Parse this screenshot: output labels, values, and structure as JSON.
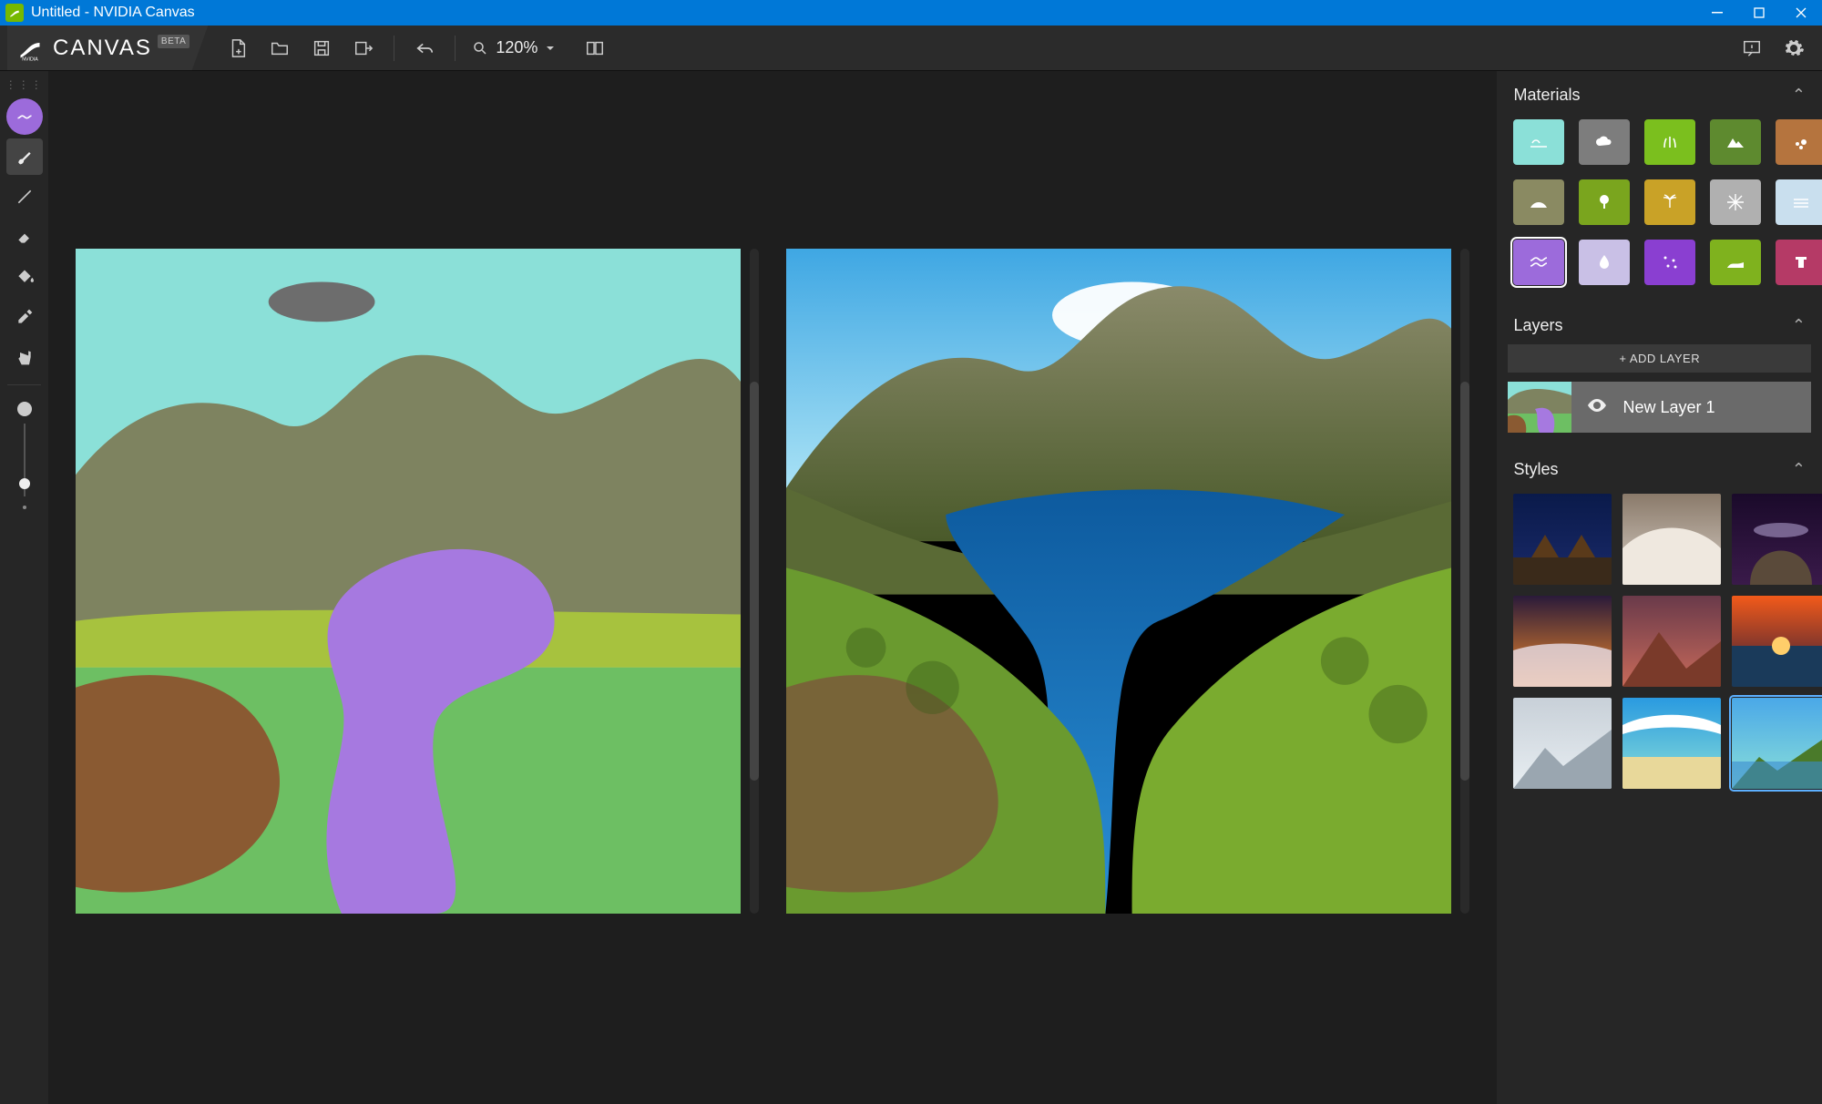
{
  "window": {
    "title": "Untitled - NVIDIA Canvas"
  },
  "brand": {
    "name": "CANVAS",
    "badge": "BETA"
  },
  "toolbar": {
    "zoom_label": "120%"
  },
  "tools": {
    "items": [
      "material",
      "brush",
      "line",
      "eraser",
      "fill",
      "eyedropper",
      "pan"
    ]
  },
  "sections": {
    "materials_title": "Materials",
    "layers_title": "Layers",
    "styles_title": "Styles",
    "add_layer_label": "+ ADD LAYER"
  },
  "materials": [
    {
      "name": "sky",
      "color": "#8be0d8",
      "icon": "sky"
    },
    {
      "name": "cloud",
      "color": "#7d7d7d",
      "icon": "cloud"
    },
    {
      "name": "grass",
      "color": "#7bbf1e",
      "icon": "grass"
    },
    {
      "name": "mountain",
      "color": "#5e8a2f",
      "icon": "mountain"
    },
    {
      "name": "dirt",
      "color": "#b5743e",
      "icon": "dirt"
    },
    {
      "name": "hill",
      "color": "#8a8a62",
      "icon": "hill"
    },
    {
      "name": "tree",
      "color": "#7aa51e",
      "icon": "tree"
    },
    {
      "name": "bush",
      "color": "#c9a227",
      "icon": "palm"
    },
    {
      "name": "snow",
      "color": "#b0b0b0",
      "icon": "snow"
    },
    {
      "name": "fog",
      "color": "#c9dfee",
      "icon": "fog"
    },
    {
      "name": "sea",
      "color": "#9c6bdb",
      "icon": "water",
      "selected": true
    },
    {
      "name": "river",
      "color": "#c9c0e6",
      "icon": "drop"
    },
    {
      "name": "stars",
      "color": "#8a3fd1",
      "icon": "stars"
    },
    {
      "name": "sand",
      "color": "#7fb21e",
      "icon": "dune"
    },
    {
      "name": "rock",
      "color": "#b53a66",
      "icon": "ruin"
    }
  ],
  "layers": [
    {
      "name": "New Layer 1",
      "visible": true
    }
  ],
  "styles": [
    {
      "name": "night-desert"
    },
    {
      "name": "cloudy-peak"
    },
    {
      "name": "arch-milkyway"
    },
    {
      "name": "sunset-clouds"
    },
    {
      "name": "red-mountain"
    },
    {
      "name": "ocean-sunset"
    },
    {
      "name": "snow-valley"
    },
    {
      "name": "tropical-beach"
    },
    {
      "name": "alpine-lake",
      "selected": true
    }
  ]
}
